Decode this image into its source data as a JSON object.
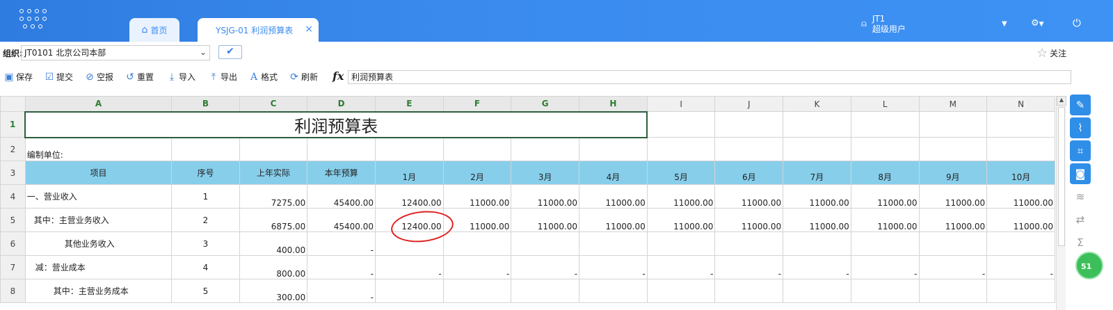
{
  "tabs": {
    "home_label": "首页",
    "active_label": "YSJG-01 利润预算表",
    "close_glyph": "×"
  },
  "user": {
    "name": "JT1",
    "role": "超级用户"
  },
  "org": {
    "label": "组织:",
    "value": "JT0101 北京公司本部",
    "confirm_glyph": "✔"
  },
  "follow_label": "关注",
  "toolbar": {
    "save": "保存",
    "submit": "提交",
    "empty_report": "空报",
    "reset": "重置",
    "import": "导入",
    "export": "导出",
    "format": "格式",
    "refresh": "刷新",
    "fx": "fx",
    "formula_value": "利润预算表"
  },
  "sheet": {
    "columns": [
      "A",
      "B",
      "C",
      "D",
      "E",
      "F",
      "G",
      "H",
      "I",
      "J",
      "K",
      "L",
      "M",
      "N"
    ],
    "rows": [
      "1",
      "2",
      "3",
      "4",
      "5",
      "6",
      "7",
      "8"
    ],
    "title": "利润预算表",
    "unit_label": "编制单位:",
    "headers": [
      "项目",
      "序号",
      "上年实际",
      "本年预算",
      "1月",
      "2月",
      "3月",
      "4月",
      "5月",
      "6月",
      "7月",
      "8月",
      "9月",
      "10月"
    ],
    "data": [
      [
        "一、营业收入",
        "1",
        "7275.00",
        "45400.00",
        "12400.00",
        "11000.00",
        "11000.00",
        "11000.00",
        "11000.00",
        "11000.00",
        "11000.00",
        "11000.00",
        "11000.00",
        "11000.00"
      ],
      [
        "其中：主营业务收入",
        "2",
        "6875.00",
        "45400.00",
        "12400.00",
        "11000.00",
        "11000.00",
        "11000.00",
        "11000.00",
        "11000.00",
        "11000.00",
        "11000.00",
        "11000.00",
        "11000.00"
      ],
      [
        "其他业务收入",
        "3",
        "400.00",
        "-",
        "",
        "",
        "",
        "",
        "",
        "",
        "",
        "",
        "",
        ""
      ],
      [
        "减：营业成本",
        "4",
        "800.00",
        "-",
        "-",
        "-",
        "-",
        "-",
        "-",
        "-",
        "-",
        "-",
        "-",
        "-"
      ],
      [
        "其中：主营业务成本",
        "5",
        "300.00",
        "-",
        "",
        "",
        "",
        "",
        "",
        "",
        "",
        "",
        "",
        ""
      ]
    ]
  },
  "side_badge": "51"
}
